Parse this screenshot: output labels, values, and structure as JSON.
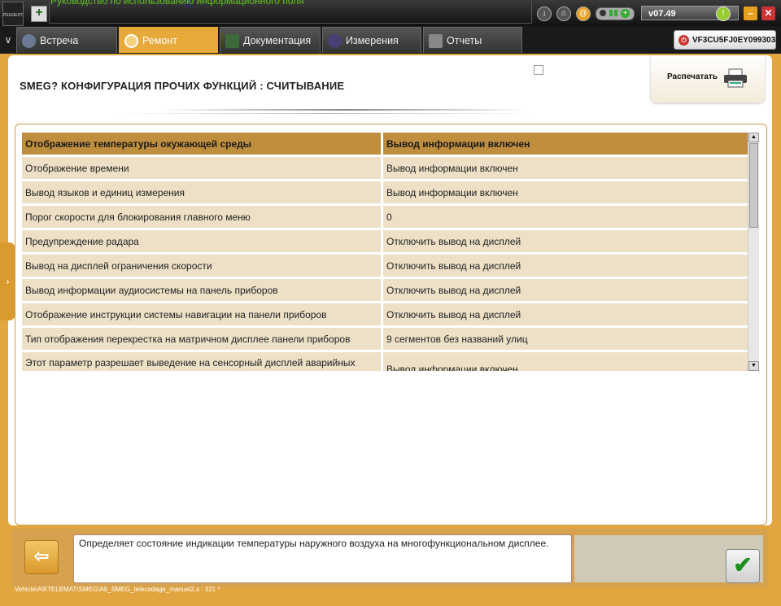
{
  "topbar": {
    "logo_text": "PEUGEOT",
    "title": "Руководство по использованию информационного поля",
    "version": "v07.49"
  },
  "icons": {
    "download": "download-icon",
    "home": "home-icon",
    "at": "at-sign-icon",
    "battery": "battery-icon",
    "help": "help-icon",
    "minimize": "minimize-icon",
    "close": "close-icon"
  },
  "tabs": [
    {
      "label": "Встреча",
      "icon": "globe-icon",
      "active": false
    },
    {
      "label": "Ремонт",
      "icon": "magnifier-icon",
      "active": true
    },
    {
      "label": "Документация",
      "icon": "book-icon",
      "active": false
    },
    {
      "label": "Измерения",
      "icon": "wave-icon",
      "active": false
    },
    {
      "label": "Отчеты",
      "icon": "report-icon",
      "active": false
    }
  ],
  "vin": "VF3CU5FJ0EY099303",
  "page": {
    "title": "SMEG?  КОНФИГУРАЦИЯ ПРОЧИХ ФУНКЦИЙ : СЧИТЫВАНИЕ",
    "print_label": "Распечатать"
  },
  "table": {
    "header": [
      "Отображение температуры окужающей среды",
      "Вывод информации включен"
    ],
    "rows": [
      [
        "Отображение времени",
        "Вывод информации включен"
      ],
      [
        "Вывод языков и единиц измерения",
        "Вывод информации включен"
      ],
      [
        "Порог скорости для блокирования главного меню",
        "0"
      ],
      [
        "Предупреждение радара",
        "Отключить вывод на дисплей"
      ],
      [
        "Вывод на дисплей ограничения скорости",
        "Отключить вывод на дисплей"
      ],
      [
        "Вывод информации аудиосистемы на панель приборов",
        "Отключить вывод на дисплей"
      ],
      [
        "Отображение инструкции системы навигации на панели приборов",
        "Отключить вывод на дисплей"
      ],
      [
        "Тип отображения перекрестка на матричном дисплее панели приборов",
        "9 сегментов без названий улиц"
      ],
      [
        "Этот параметр разрешает выведение на сенсорный дисплей аварийных",
        "Вывод информации включен"
      ]
    ]
  },
  "description": "Определяет состояние индикации температуры наружного воздуха на многофункциональном дисплее.",
  "footer_path": "Vehicle\\A9\\TELEMAT\\SMEG\\A9_SMEG_telecodage_manuel2.s : 321 *",
  "colors": {
    "frame": "#e2a540",
    "header_row": "#bf8e3e",
    "row": "#ede0c6",
    "active_tab": "#e6a93a"
  }
}
